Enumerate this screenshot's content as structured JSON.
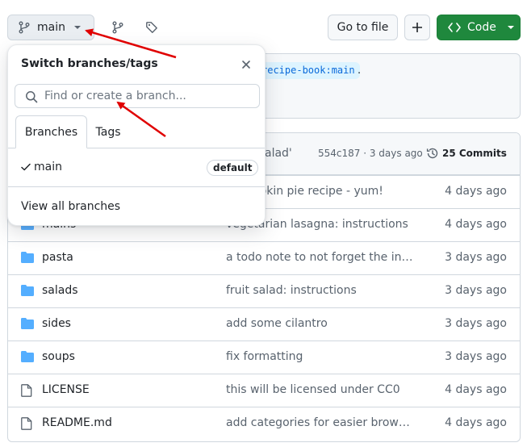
{
  "toolbar": {
    "branch_label": "main",
    "go_to_file_label": "Go to file",
    "add_label": "+",
    "code_label": "Code"
  },
  "notice": {
    "fork_source": "recipe-book:main",
    "trailing": "."
  },
  "commit_header": {
    "message": "alad'",
    "meta": "554c187 · 3 days ago",
    "commits_label": "25 Commits"
  },
  "files": [
    {
      "name": "",
      "message": "t pumpkin pie recipe - yum!",
      "date": "4 days ago",
      "type": "folder"
    },
    {
      "name": "mains",
      "message": "vegetarian lasagna: instructions",
      "date": "4 days ago",
      "type": "folder"
    },
    {
      "name": "pasta",
      "message": "a todo note to not forget the inst…",
      "date": "3 days ago",
      "type": "folder"
    },
    {
      "name": "salads",
      "message": "fruit salad: instructions",
      "date": "3 days ago",
      "type": "folder"
    },
    {
      "name": "sides",
      "message": "add some cilantro",
      "date": "3 days ago",
      "type": "folder"
    },
    {
      "name": "soups",
      "message": "fix formatting",
      "date": "3 days ago",
      "type": "folder"
    },
    {
      "name": "LICENSE",
      "message": "this will be licensed under CC0",
      "date": "4 days ago",
      "type": "file"
    },
    {
      "name": "README.md",
      "message": "add categories for easier browsing",
      "date": "4 days ago",
      "type": "file"
    }
  ],
  "dropdown": {
    "title": "Switch branches/tags",
    "search_placeholder": "Find or create a branch...",
    "tabs": [
      "Branches",
      "Tags"
    ],
    "branch_name": "main",
    "default_badge": "default",
    "view_all": "View all branches"
  },
  "colors": {
    "accent_green": "#1f883d",
    "folder_blue": "#54aeff",
    "annotation_red": "#e00000"
  }
}
